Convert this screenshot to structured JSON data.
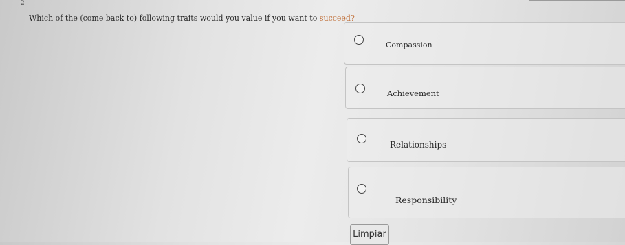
{
  "question": {
    "number": "2",
    "text": "Which of the (come back to) following traits would you value if you want to ",
    "text_tail": "succeed?"
  },
  "options": [
    {
      "label": "Compassion"
    },
    {
      "label": "Achievement"
    },
    {
      "label": "Relationships"
    },
    {
      "label": "Responsibility"
    }
  ],
  "clear_button": {
    "label": "Limpiar"
  }
}
